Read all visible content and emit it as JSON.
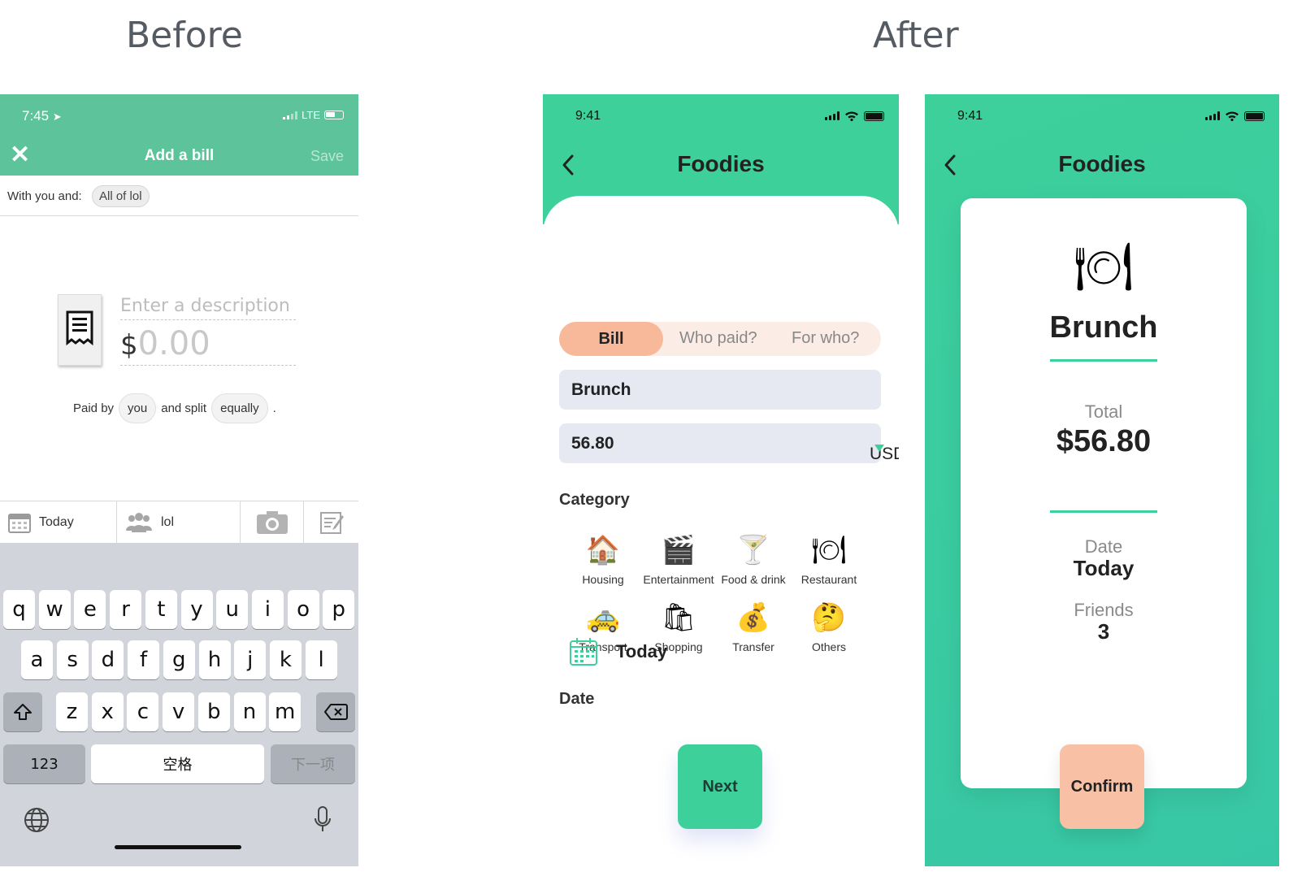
{
  "headings": {
    "before": "Before",
    "after": "After"
  },
  "before": {
    "status": {
      "time": "7:45",
      "network": "LTE"
    },
    "nav": {
      "title": "Add a bill",
      "save": "Save"
    },
    "with": {
      "label": "With you and:",
      "chip": "All of lol"
    },
    "description_placeholder": "Enter a description",
    "amount": {
      "currency": "$",
      "value": "0.00"
    },
    "paid": {
      "prefix": "Paid by",
      "payer": "you",
      "middle": "and split",
      "method": "equally",
      "suffix": "."
    },
    "toolbar": {
      "date": "Today",
      "group": "lol"
    },
    "keyboard": {
      "row1": [
        "q",
        "w",
        "e",
        "r",
        "t",
        "y",
        "u",
        "i",
        "o",
        "p"
      ],
      "row2": [
        "a",
        "s",
        "d",
        "f",
        "g",
        "h",
        "j",
        "k",
        "l"
      ],
      "row3": [
        "z",
        "x",
        "c",
        "v",
        "b",
        "n",
        "m"
      ],
      "numbers": "123",
      "space": "空格",
      "next": "下一项"
    }
  },
  "phone1": {
    "time": "9:41",
    "title": "Foodies",
    "tabs": [
      "Bill",
      "Who paid?",
      "For who?"
    ],
    "description": "Brunch",
    "amount": "56.80",
    "currency": "USD",
    "category_label": "Category",
    "categories": [
      {
        "label": "Housing",
        "emoji": "🏠"
      },
      {
        "label": "Entertainment",
        "emoji": "🎬"
      },
      {
        "label": "Food & drink",
        "emoji": "🍸"
      },
      {
        "label": "Restaurant",
        "emoji": "🍽"
      },
      {
        "label": "Transport",
        "emoji": "🚕"
      },
      {
        "label": "Shopping",
        "emoji": "🛍"
      },
      {
        "label": "Transfer",
        "emoji": "💰"
      },
      {
        "label": "Others",
        "emoji": "🤔"
      }
    ],
    "date_label": "Date",
    "date_value": "Today",
    "next": "Next"
  },
  "phone2": {
    "time": "9:41",
    "title": "Foodies",
    "icon": "🍽",
    "name": "Brunch",
    "total_label": "Total",
    "total": "$56.80",
    "date_label": "Date",
    "date": "Today",
    "friends_label": "Friends",
    "friends": "3",
    "confirm": "Confirm"
  },
  "colors": {
    "before_green": "#5cc39a",
    "brand_green": "#3dd09b",
    "peach": "#f8b99a"
  }
}
